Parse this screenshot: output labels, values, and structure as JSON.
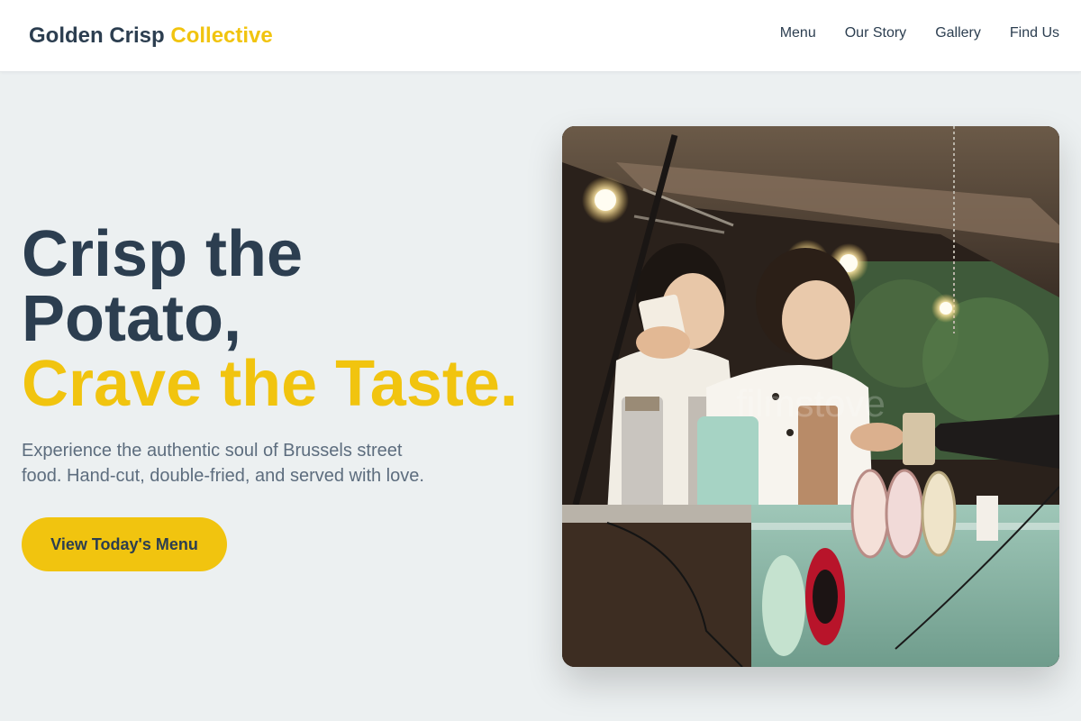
{
  "header": {
    "logo_main": "Golden Crisp",
    "logo_accent": "Collective",
    "nav": [
      "Menu",
      "Our Story",
      "Gallery",
      "Find Us"
    ]
  },
  "hero": {
    "title_line1": "Crisp the",
    "title_line2": "Potato,",
    "title_accent": "Crave the Taste.",
    "subtitle": "Experience the authentic soul of Brussels street food. Hand-cut, double-fried, and served with love.",
    "cta_label": "View Today's Menu"
  },
  "photo": {
    "watermark": "filmstove"
  },
  "colors": {
    "accent": "#f1c40f",
    "text_dark": "#2c3e50",
    "text_muted": "#5d6d7e",
    "page_bg": "#ecf0f1"
  }
}
